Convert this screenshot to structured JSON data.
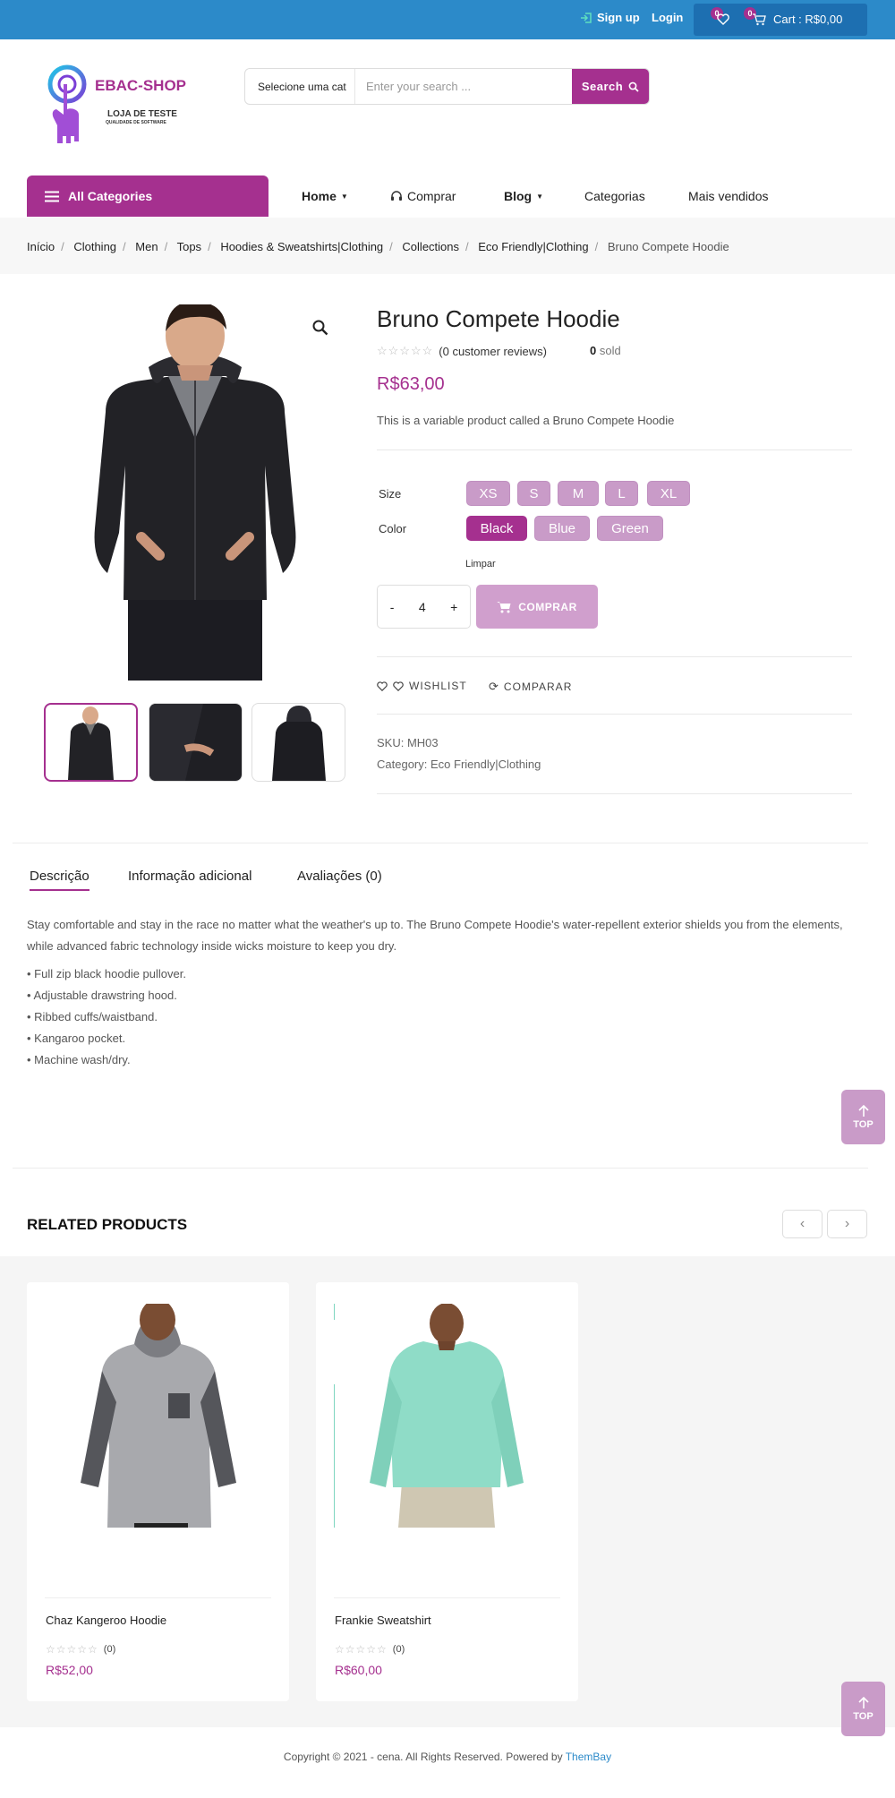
{
  "topbar": {
    "signup": "Sign up",
    "login": "Login",
    "wishlist_count": "0",
    "cart_count": "0",
    "cart_label": "Cart : R$0,00"
  },
  "logo": {
    "title": "EBAC-SHOP",
    "subtitle": "LOJA DE TESTE",
    "tagline": "QUALIDADE DE SOFTWARE"
  },
  "search": {
    "category": "Selecione uma cat",
    "placeholder": "Enter your search ...",
    "button": "Search"
  },
  "nav": {
    "all_categories": "All Categories",
    "items": [
      "Home",
      "Comprar",
      "Blog",
      "Categorias",
      "Mais vendidos"
    ]
  },
  "breadcrumb": [
    "Início",
    "Clothing",
    "Men",
    "Tops",
    "Hoodies & Sweatshirts|Clothing",
    "Collections",
    "Eco Friendly|Clothing",
    "Bruno Compete Hoodie"
  ],
  "product": {
    "title": "Bruno Compete Hoodie",
    "reviews": "(0 customer reviews)",
    "sold_count": "0",
    "sold_label": "sold",
    "price": "R$63,00",
    "short_desc": "This is a variable product called a Bruno Compete Hoodie",
    "size_label": "Size",
    "sizes": [
      "XS",
      "S",
      "M",
      "L",
      "XL"
    ],
    "color_label": "Color",
    "colors": [
      "Black",
      "Blue",
      "Green"
    ],
    "selected_color": "Black",
    "clear": "Limpar",
    "qty_minus": "-",
    "quantity": "4",
    "qty_plus": "+",
    "buy": "COMPRAR",
    "wishlist": "WISHLIST",
    "compare": "COMPARAR",
    "sku_label": "SKU:",
    "sku": "MH03",
    "category_label": "Category:",
    "category": "Eco Friendly|Clothing"
  },
  "tabs": [
    "Descrição",
    "Informação adicional",
    "Avaliações (0)"
  ],
  "description": {
    "paragraph": "Stay comfortable and stay in the race no matter what the weather's up to. The Bruno Compete Hoodie's water-repellent exterior shields you from the elements, while advanced fabric technology inside wicks moisture to keep you dry.",
    "bullets": [
      "• Full zip black hoodie pullover.",
      "• Adjustable drawstring hood.",
      "• Ribbed cuffs/waistband.",
      "• Kangaroo pocket.",
      "• Machine wash/dry."
    ]
  },
  "top_button": "TOP",
  "related": {
    "heading": "RELATED PRODUCTS",
    "products": [
      {
        "name": "Chaz Kangeroo Hoodie",
        "reviews": "(0)",
        "price": "R$52,00"
      },
      {
        "name": "Frankie Sweatshirt",
        "reviews": "(0)",
        "price": "R$60,00"
      }
    ]
  },
  "footer": {
    "text": "Copyright © 2021 - cena. All Rights Reserved. Powered by",
    "link": "ThemBay"
  },
  "colors": {
    "accent": "#a5308f",
    "accent_light": "#c99bc8",
    "topbar": "#2c8ac9",
    "cartbox": "#1d6fb1"
  }
}
